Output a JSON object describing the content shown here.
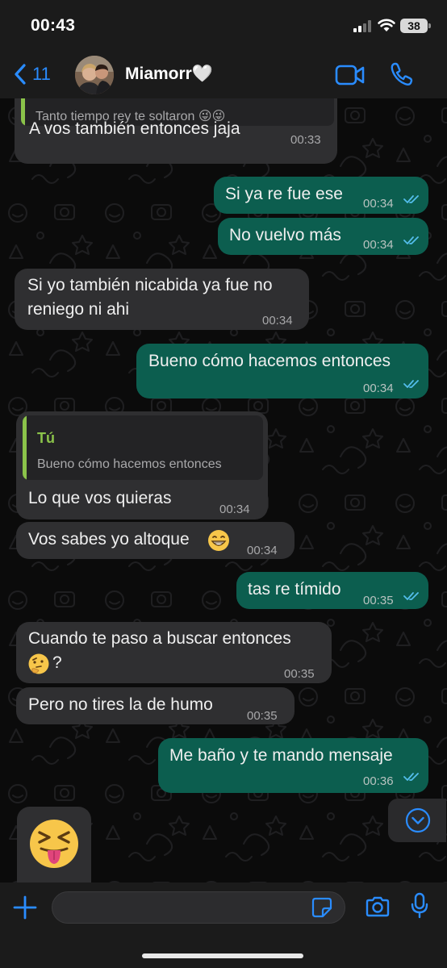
{
  "status": {
    "time": "00:43",
    "battery": "38"
  },
  "header": {
    "back_count": "11",
    "contact_name": "Miamorr🤍"
  },
  "messages": [
    {
      "quote_text": "Tanto tiempo rey te soltaron 😜😜",
      "text": "A vos también entonces jaja",
      "time": "00:33"
    },
    {
      "text": "Si ya re fue ese",
      "time": "00:34"
    },
    {
      "text": "No vuelvo más",
      "time": "00:34"
    },
    {
      "text_line1": "Si yo también nicabida ya fue no",
      "text_line2": "reniego ni ahi",
      "time": "00:34"
    },
    {
      "text": "Bueno cómo hacemos entonces",
      "time": "00:34"
    },
    {
      "quote_author": "Tú",
      "quote_text": "Bueno cómo hacemos entonces",
      "text": "Lo que vos quieras",
      "time": "00:34"
    },
    {
      "text": "Vos sabes yo altoque",
      "time": "00:34"
    },
    {
      "text": "tas re tímido",
      "time": "00:35"
    },
    {
      "text_line1": "Cuando te paso a buscar entonces",
      "text_line2": "?",
      "time": "00:35"
    },
    {
      "text": "Pero no tires la de humo",
      "time": "00:35"
    },
    {
      "text": "Me baño y te mando mensaje",
      "time": "00:36"
    }
  ],
  "input": {
    "placeholder": "",
    "value": ""
  },
  "colors": {
    "accent": "#2a8cff",
    "incoming_bubble": "#2f2f31",
    "outgoing_bubble": "#0c5e4f",
    "read_ticks": "#53bdeb",
    "quote_bar": "#8bc34a"
  },
  "icons": [
    "chevron-left-icon",
    "video-camera-icon",
    "phone-icon",
    "double-check-icon",
    "chevron-down-icon",
    "plus-icon",
    "sticker-icon",
    "camera-icon",
    "microphone-icon"
  ]
}
